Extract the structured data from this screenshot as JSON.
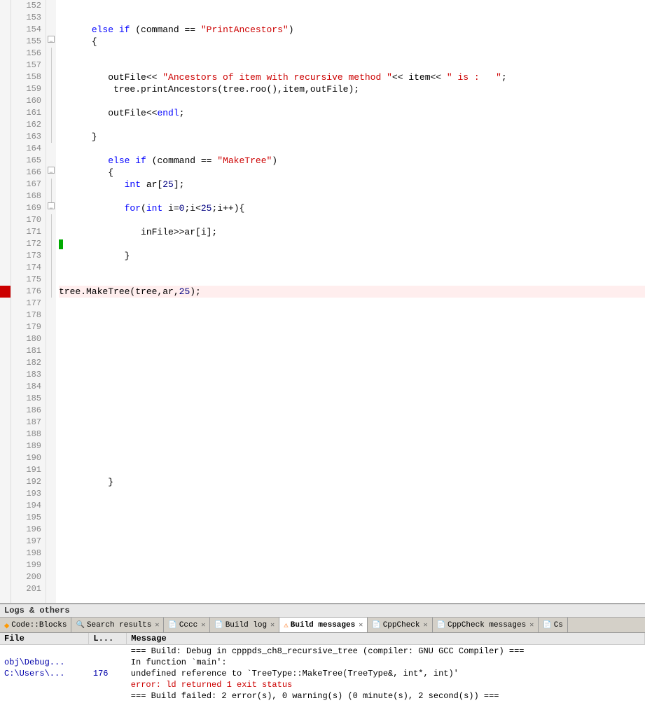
{
  "editor": {
    "lines": [
      {
        "num": 152,
        "content": "",
        "fold": "",
        "bookmark": ""
      },
      {
        "num": 153,
        "content": "",
        "fold": "",
        "bookmark": ""
      },
      {
        "num": 154,
        "content": "      else if (command == \"PrintAncestors\")",
        "fold": "",
        "bookmark": ""
      },
      {
        "num": 155,
        "content": "      {",
        "fold": "open",
        "bookmark": ""
      },
      {
        "num": 156,
        "content": "",
        "fold": "|",
        "bookmark": ""
      },
      {
        "num": 157,
        "content": "",
        "fold": "|",
        "bookmark": ""
      },
      {
        "num": 158,
        "content": "         outFile<< \"Ancestors of item with recursive method \"<< item<< \" is :   \";",
        "fold": "|",
        "bookmark": ""
      },
      {
        "num": 159,
        "content": "          tree.printAncestors(tree.roo(),item,outFile);",
        "fold": "|",
        "bookmark": ""
      },
      {
        "num": 160,
        "content": "",
        "fold": "|",
        "bookmark": ""
      },
      {
        "num": 161,
        "content": "         outFile<<endl;",
        "fold": "|",
        "bookmark": ""
      },
      {
        "num": 162,
        "content": "",
        "fold": "|",
        "bookmark": ""
      },
      {
        "num": 163,
        "content": "      }",
        "fold": "|",
        "bookmark": ""
      },
      {
        "num": 164,
        "content": "",
        "fold": "",
        "bookmark": ""
      },
      {
        "num": 165,
        "content": "         else if (command == \"MakeTree\")",
        "fold": "",
        "bookmark": ""
      },
      {
        "num": 166,
        "content": "         {",
        "fold": "open",
        "bookmark": ""
      },
      {
        "num": 167,
        "content": "            int ar[25];",
        "fold": "|",
        "bookmark": ""
      },
      {
        "num": 168,
        "content": "",
        "fold": "|",
        "bookmark": ""
      },
      {
        "num": 169,
        "content": "            for(int i=0;i<25;i++){",
        "fold": "open",
        "bookmark": ""
      },
      {
        "num": 170,
        "content": "",
        "fold": "|",
        "bookmark": ""
      },
      {
        "num": 171,
        "content": "               inFile>>ar[i];",
        "fold": "|",
        "bookmark": ""
      },
      {
        "num": 172,
        "content": "",
        "fold": "|",
        "bookmark": "green"
      },
      {
        "num": 173,
        "content": "            }",
        "fold": "|",
        "bookmark": ""
      },
      {
        "num": 174,
        "content": "",
        "fold": "|",
        "bookmark": ""
      },
      {
        "num": 175,
        "content": "",
        "fold": "|",
        "bookmark": ""
      },
      {
        "num": 176,
        "content": "tree.MakeTree(tree,ar,25);",
        "fold": "|",
        "bookmark": "red",
        "breakpoint": true
      },
      {
        "num": 177,
        "content": "",
        "fold": "",
        "bookmark": ""
      },
      {
        "num": 178,
        "content": "",
        "fold": "",
        "bookmark": ""
      },
      {
        "num": 179,
        "content": "",
        "fold": "",
        "bookmark": ""
      },
      {
        "num": 180,
        "content": "",
        "fold": "",
        "bookmark": ""
      },
      {
        "num": 181,
        "content": "",
        "fold": "",
        "bookmark": ""
      },
      {
        "num": 182,
        "content": "",
        "fold": "",
        "bookmark": ""
      },
      {
        "num": 183,
        "content": "",
        "fold": "",
        "bookmark": ""
      },
      {
        "num": 184,
        "content": "",
        "fold": "",
        "bookmark": ""
      },
      {
        "num": 185,
        "content": "",
        "fold": "",
        "bookmark": ""
      },
      {
        "num": 186,
        "content": "",
        "fold": "",
        "bookmark": ""
      },
      {
        "num": 187,
        "content": "",
        "fold": "",
        "bookmark": ""
      },
      {
        "num": 188,
        "content": "",
        "fold": "",
        "bookmark": ""
      },
      {
        "num": 189,
        "content": "",
        "fold": "",
        "bookmark": ""
      },
      {
        "num": 190,
        "content": "",
        "fold": "",
        "bookmark": ""
      },
      {
        "num": 191,
        "content": "",
        "fold": "",
        "bookmark": ""
      },
      {
        "num": 192,
        "content": "         }",
        "fold": "",
        "bookmark": ""
      },
      {
        "num": 193,
        "content": "",
        "fold": "",
        "bookmark": ""
      },
      {
        "num": 194,
        "content": "",
        "fold": "",
        "bookmark": ""
      },
      {
        "num": 195,
        "content": "",
        "fold": "",
        "bookmark": ""
      },
      {
        "num": 196,
        "content": "",
        "fold": "",
        "bookmark": ""
      },
      {
        "num": 197,
        "content": "",
        "fold": "",
        "bookmark": ""
      },
      {
        "num": 198,
        "content": "",
        "fold": "",
        "bookmark": ""
      },
      {
        "num": 199,
        "content": "",
        "fold": "",
        "bookmark": ""
      },
      {
        "num": 200,
        "content": "",
        "fold": "",
        "bookmark": ""
      },
      {
        "num": 201,
        "content": "",
        "fold": "",
        "bookmark": ""
      }
    ]
  },
  "bottom_panel": {
    "logs_label": "Logs & others",
    "tabs": [
      {
        "id": "codeblocks",
        "label": "Code::Blocks",
        "icon": "cb",
        "active": false,
        "closable": false
      },
      {
        "id": "search-results",
        "label": "Search results",
        "icon": "search",
        "active": false,
        "closable": true
      },
      {
        "id": "cccc",
        "label": "Cccc",
        "icon": "doc",
        "active": false,
        "closable": true
      },
      {
        "id": "build-log",
        "label": "Build log",
        "icon": "doc",
        "active": false,
        "closable": true
      },
      {
        "id": "build-messages",
        "label": "Build messages",
        "icon": "warn",
        "active": true,
        "closable": true
      },
      {
        "id": "cppcheck",
        "label": "CppCheck",
        "icon": "doc",
        "active": false,
        "closable": true
      },
      {
        "id": "cppcheck-messages",
        "label": "CppCheck messages",
        "icon": "doc",
        "active": false,
        "closable": true
      },
      {
        "id": "cs",
        "label": "Cs",
        "icon": "doc",
        "active": false,
        "closable": false
      }
    ],
    "output": {
      "columns": [
        "File",
        "L...",
        "Message"
      ],
      "rows": [
        {
          "file": "",
          "line": "",
          "message": "=== Build: Debug in cpppds_ch8_recursive_tree (compiler: GNU GCC Compiler) ===",
          "type": "normal"
        },
        {
          "file": "obj\\Debug...",
          "line": "",
          "message": "In function `main':",
          "type": "normal"
        },
        {
          "file": "C:\\Users\\...",
          "line": "176",
          "message": "undefined reference to `TreeType::MakeTree(TreeType&, int*, int)'",
          "type": "normal"
        },
        {
          "file": "",
          "line": "",
          "message": "error: ld returned 1 exit status",
          "type": "error"
        },
        {
          "file": "",
          "line": "",
          "message": "=== Build failed: 2 error(s), 0 warning(s) (0 minute(s), 2 second(s)) ===",
          "type": "normal"
        }
      ]
    }
  }
}
